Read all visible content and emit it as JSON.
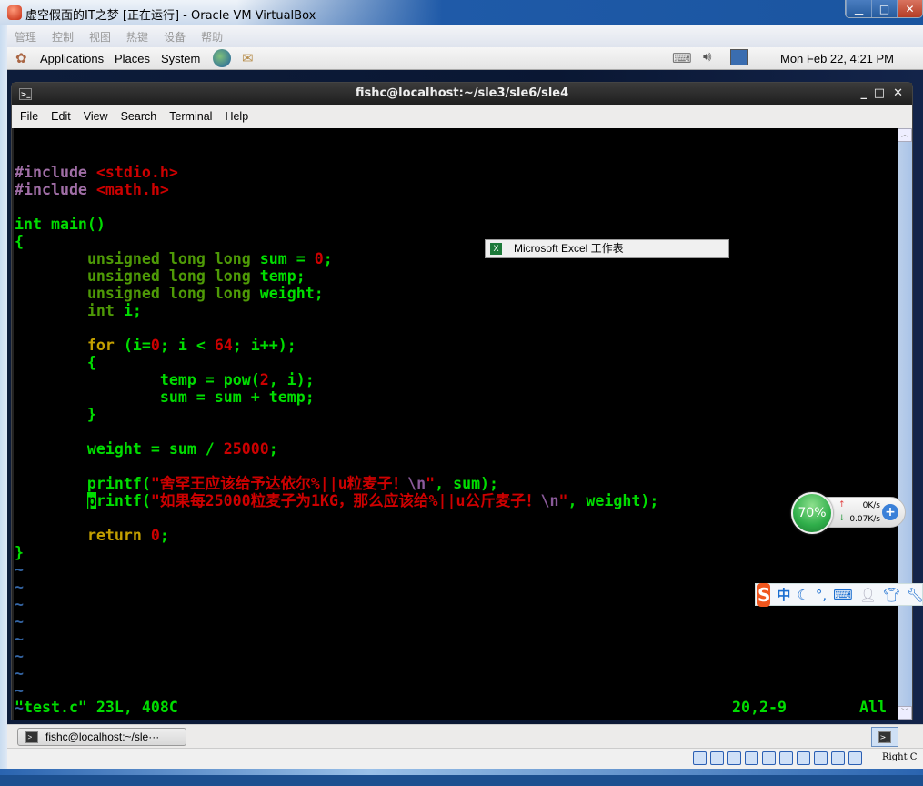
{
  "vbox": {
    "title": "虚空假面的IT之梦 [正在运行] - Oracle VM VirtualBox",
    "menu": [
      "管理",
      "控制",
      "视图",
      "热键",
      "设备",
      "帮助"
    ],
    "host_key": "Right C"
  },
  "panel": {
    "menus": [
      "Applications",
      "Places",
      "System"
    ],
    "clock": "Mon Feb 22,  4:21 PM"
  },
  "terminal": {
    "title": "fishc@localhost:~/sle3/sle6/sle4",
    "menu": [
      "File",
      "Edit",
      "View",
      "Search",
      "Terminal",
      "Help"
    ],
    "lines": [
      [
        [
          "#include ",
          "pp"
        ],
        [
          "<stdio.h>",
          "str"
        ]
      ],
      [
        [
          "#include ",
          "pp"
        ],
        [
          "<math.h>",
          "str"
        ]
      ],
      [],
      [
        [
          "int main()",
          "g"
        ]
      ],
      [
        [
          "{",
          "g"
        ]
      ],
      [
        [
          "        "
        ],
        [
          "unsigned long long ",
          "ty"
        ],
        [
          "sum = ",
          "g"
        ],
        [
          "0",
          "str"
        ],
        [
          ";",
          "g"
        ]
      ],
      [
        [
          "        "
        ],
        [
          "unsigned long long ",
          "ty"
        ],
        [
          "temp;",
          "g"
        ]
      ],
      [
        [
          "        "
        ],
        [
          "unsigned long long ",
          "ty"
        ],
        [
          "weight;",
          "g"
        ]
      ],
      [
        [
          "        "
        ],
        [
          "int ",
          "ty"
        ],
        [
          "i;",
          "g"
        ]
      ],
      [],
      [
        [
          "        "
        ],
        [
          "for ",
          "kw"
        ],
        [
          "(i=",
          "g"
        ],
        [
          "0",
          "str"
        ],
        [
          "; i < ",
          "g"
        ],
        [
          "64",
          "str"
        ],
        [
          "; i++);",
          "g"
        ]
      ],
      [
        [
          "        {",
          "g"
        ]
      ],
      [
        [
          "                temp = pow(",
          "g"
        ],
        [
          "2",
          "str"
        ],
        [
          ", i);",
          "g"
        ]
      ],
      [
        [
          "                sum = sum + temp;",
          "g"
        ]
      ],
      [
        [
          "        }",
          "g"
        ]
      ],
      [],
      [
        [
          "        weight = sum / ",
          "g"
        ],
        [
          "25000",
          "str"
        ],
        [
          ";",
          "g"
        ]
      ],
      [],
      [
        [
          "        printf(",
          "g"
        ],
        [
          "\"舍罕王应该给予达依尔%||u粒麦子！",
          "str"
        ],
        [
          "\\n",
          "esc"
        ],
        [
          "\"",
          "str"
        ],
        [
          ", sum);",
          "g"
        ]
      ],
      [
        [
          "        "
        ],
        [
          "p",
          "cur"
        ],
        [
          "rintf(",
          "g"
        ],
        [
          "\"如果每25000粒麦子为1KG，那么应该给%||u公斤麦子！",
          "str"
        ],
        [
          "\\n",
          "esc"
        ],
        [
          "\"",
          "str"
        ],
        [
          ", weight);",
          "g"
        ]
      ],
      [],
      [
        [
          "        "
        ],
        [
          "return ",
          "kw"
        ],
        [
          "0",
          "str"
        ],
        [
          ";",
          "g"
        ]
      ],
      [
        [
          "}",
          "g"
        ]
      ],
      [
        [
          "~",
          "tl"
        ]
      ],
      [
        [
          "~",
          "tl"
        ]
      ],
      [
        [
          "~",
          "tl"
        ]
      ],
      [
        [
          "~",
          "tl"
        ]
      ],
      [
        [
          "~",
          "tl"
        ]
      ],
      [
        [
          "~",
          "tl"
        ]
      ],
      [
        [
          "~",
          "tl"
        ]
      ],
      [
        [
          "~",
          "tl"
        ]
      ],
      [
        [
          "~",
          "tl"
        ]
      ],
      [
        [
          "~",
          "tl"
        ]
      ]
    ],
    "status": {
      "file": "\"test.c\" 23L, 408C",
      "position": "20,2-9",
      "scroll": "All"
    }
  },
  "popup": {
    "excel_label": "Microsoft Excel 工作表"
  },
  "net_widget": {
    "percent": "70%",
    "upload": "0K/s",
    "download": "0.07K/s"
  },
  "ime": {
    "mode": "中"
  },
  "taskbar": {
    "task_label": "fishc@localhost:~/sle···"
  }
}
